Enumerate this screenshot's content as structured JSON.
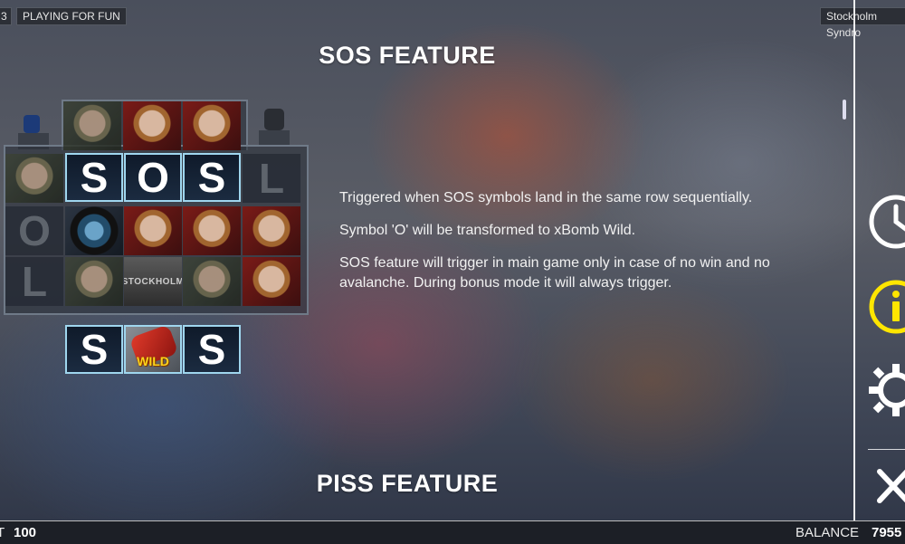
{
  "top_bar": {
    "left_fragment": "3",
    "mode_badge": "PLAYING FOR FUN",
    "game_title_badge": "Stockholm Syndro"
  },
  "sections": [
    {
      "title": "SOS FEATURE",
      "paragraphs": [
        "Triggered when SOS symbols land in the same row sequentially.",
        "Symbol 'O' will be transformed to xBomb Wild.",
        "SOS feature will trigger in main game only in case of no win and no avalanche. During bonus mode it will always trigger."
      ]
    },
    {
      "title": "PISS FEATURE"
    }
  ],
  "illustration": {
    "row1_letters": [
      "S",
      "O",
      "S"
    ],
    "dim_letters": [
      "L",
      "O",
      "L"
    ],
    "result_letters": [
      "S",
      "S"
    ],
    "wild_label": "WILD",
    "logo_text": "STOCKHOLM"
  },
  "sidebar": {
    "icons": [
      "clock-icon",
      "info-icon",
      "gear-icon",
      "close-icon"
    ],
    "accent_color": "#ffe600"
  },
  "bottom_bar": {
    "bet_label": "T",
    "bet_value": "100",
    "balance_label": "BALANCE",
    "balance_value": "7955"
  }
}
